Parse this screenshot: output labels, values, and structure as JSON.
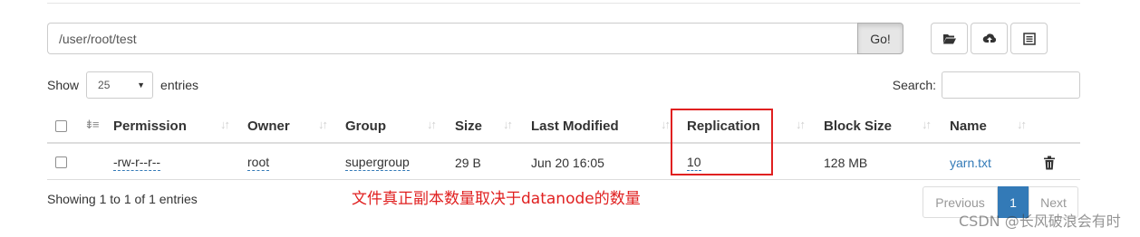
{
  "path_bar": {
    "value": "/user/root/test",
    "go_label": "Go!"
  },
  "toolbar": {
    "icons": [
      "folder-open-icon",
      "cloud-upload-icon",
      "list-alt-icon"
    ]
  },
  "length_menu": {
    "show_label": "Show",
    "selected": "25",
    "entries_label": "entries"
  },
  "search": {
    "label": "Search:",
    "value": ""
  },
  "table": {
    "columns": [
      "Permission",
      "Owner",
      "Group",
      "Size",
      "Last Modified",
      "Replication",
      "Block Size",
      "Name"
    ],
    "rows": [
      {
        "permission": "-rw-r--r--",
        "owner": "root",
        "group": "supergroup",
        "size": "29 B",
        "last_modified": "Jun 20 16:05",
        "replication": "10",
        "block_size": "128 MB",
        "name": "yarn.txt"
      }
    ]
  },
  "footer": {
    "info": "Showing 1 to 1 of 1 entries"
  },
  "pagination": {
    "previous": "Previous",
    "current": "1",
    "next": "Next"
  },
  "annotation": {
    "text": "文件真正副本数量取决于datanode的数量",
    "color": "#e02020"
  },
  "watermark": "CSDN @长风破浪会有时",
  "colors": {
    "link": "#337ab7",
    "annotation": "#e02020",
    "active_page": "#337ab7"
  }
}
